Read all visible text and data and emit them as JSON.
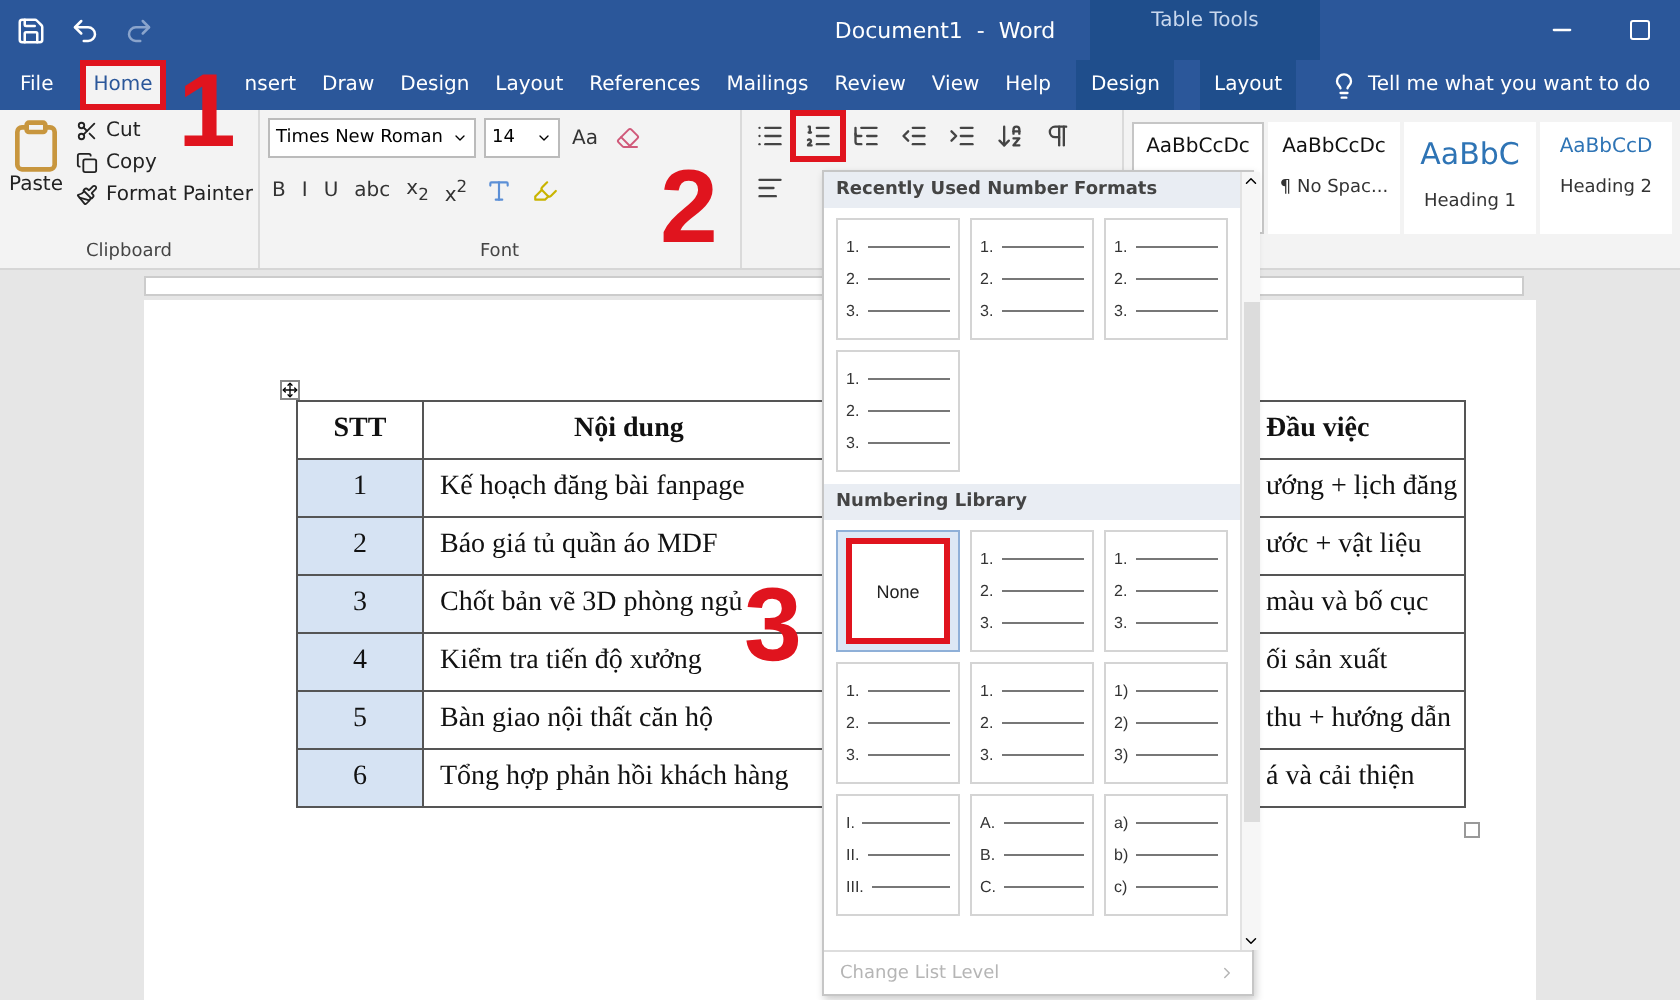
{
  "title_bar": {
    "title": "Document1  -  Word",
    "context_label": "Table Tools"
  },
  "tabs": [
    {
      "label": "File",
      "selected": false,
      "context": false,
      "highlighted": false
    },
    {
      "label": "Home",
      "selected": true,
      "context": false,
      "highlighted": true
    },
    {
      "label": "nsert",
      "selected": false,
      "context": false,
      "highlighted": false
    },
    {
      "label": "Draw",
      "selected": false,
      "context": false,
      "highlighted": false
    },
    {
      "label": "Design",
      "selected": false,
      "context": false,
      "highlighted": false
    },
    {
      "label": "Layout",
      "selected": false,
      "context": false,
      "highlighted": false
    },
    {
      "label": "References",
      "selected": false,
      "context": false,
      "highlighted": false
    },
    {
      "label": "Mailings",
      "selected": false,
      "context": false,
      "highlighted": false
    },
    {
      "label": "Review",
      "selected": false,
      "context": false,
      "highlighted": false
    },
    {
      "label": "View",
      "selected": false,
      "context": false,
      "highlighted": false
    },
    {
      "label": "Help",
      "selected": false,
      "context": false,
      "highlighted": false
    },
    {
      "label": "Design",
      "selected": false,
      "context": true,
      "highlighted": false
    },
    {
      "label": "Layout",
      "selected": false,
      "context": true,
      "highlighted": false
    }
  ],
  "tell_me": "Tell me what you want to do",
  "clipboard": {
    "paste": "Paste",
    "items": [
      "Cut",
      "Copy",
      "Format Painter"
    ],
    "group": "Clipboard"
  },
  "font": {
    "name": "Times New Roman",
    "size": "14",
    "change_case": "Aa",
    "format_buttons": [
      "B",
      "I",
      "U",
      "abc",
      "x$_{2}$",
      "x$^{2}$"
    ],
    "group": "Font"
  },
  "paragraph": {
    "numbering_highlighted": true
  },
  "styles": [
    {
      "preview": "AaBbCcDc",
      "selected": true,
      "kind": "normal"
    },
    {
      "preview": "AaBbCcDc",
      "name": "¶ No Spac...",
      "selected": false,
      "kind": "normal"
    },
    {
      "preview": "AaBbC",
      "name": "Heading 1",
      "selected": false,
      "kind": "heading"
    },
    {
      "preview": "AaBbCcD",
      "name": "Heading 2",
      "selected": false,
      "kind": "heading2"
    }
  ],
  "numbering_menu": {
    "recent_title": "Recently Used Number Formats",
    "recent": [
      {
        "kind": "list",
        "markers": [
          "1.",
          "2.",
          "3."
        ]
      },
      {
        "kind": "list",
        "markers": [
          "1.",
          "2.",
          "3."
        ]
      },
      {
        "kind": "list",
        "markers": [
          "1.",
          "2.",
          "3."
        ]
      },
      {
        "kind": "list",
        "markers": [
          "1.",
          "2.",
          "3."
        ]
      }
    ],
    "library_title": "Numbering Library",
    "library": [
      {
        "kind": "none",
        "label": "None",
        "selected": true,
        "highlighted": true
      },
      {
        "kind": "list",
        "markers": [
          "1.",
          "2.",
          "3."
        ],
        "selected": false
      },
      {
        "kind": "list",
        "markers": [
          "1.",
          "2.",
          "3."
        ],
        "selected": false
      },
      {
        "kind": "list",
        "markers": [
          "1.",
          "2.",
          "3."
        ],
        "selected": false
      },
      {
        "kind": "list",
        "markers": [
          "1.",
          "2.",
          "3."
        ],
        "selected": false
      },
      {
        "kind": "list",
        "markers": [
          "1)",
          "2)",
          "3)"
        ],
        "selected": false
      },
      {
        "kind": "list",
        "markers": [
          "I.",
          "II.",
          "III."
        ],
        "selected": false
      },
      {
        "kind": "list",
        "markers": [
          "A.",
          "B.",
          "C."
        ],
        "selected": false
      },
      {
        "kind": "list",
        "markers": [
          "a)",
          "b)",
          "c)"
        ],
        "selected": false
      }
    ],
    "footer": "Change List Level",
    "footer_disabled": true
  },
  "table": {
    "columns": [
      {
        "label": "STT",
        "selected": true
      },
      {
        "label": "Nội dung",
        "selected": false
      },
      {
        "label": "Đầu việc",
        "selected": false
      }
    ],
    "rows": [
      [
        "1",
        "Kế hoạch đăng bài fanpage",
        "ướng + lịch đăng"
      ],
      [
        "2",
        "Báo giá tủ quần áo MDF",
        "ước + vật liệu"
      ],
      [
        "3",
        "Chốt bản vẽ 3D phòng ngủ",
        "màu và bố cục"
      ],
      [
        "4",
        "Kiểm tra tiến độ xưởng",
        "ối sản xuất"
      ],
      [
        "5",
        "Bàn giao nội thất căn hộ",
        "thu + hướng dẫn"
      ],
      [
        "6",
        "Tổng hợp phản hồi khách hàng",
        "á và cải thiện"
      ]
    ]
  },
  "annotations": [
    {
      "label": "1"
    },
    {
      "label": "2"
    },
    {
      "label": "3"
    }
  ]
}
